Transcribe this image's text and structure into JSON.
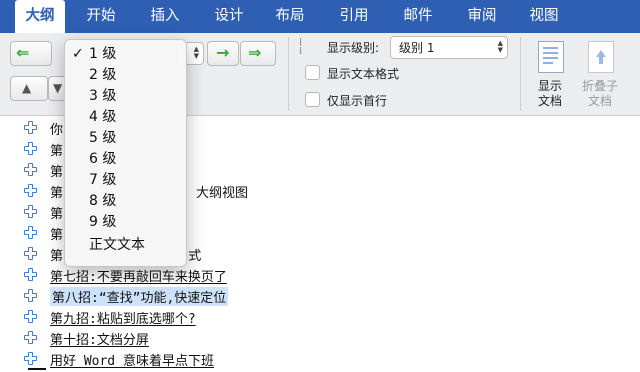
{
  "tabs": [
    "大纲",
    "开始",
    "插入",
    "设计",
    "布局",
    "引用",
    "邮件",
    "审阅",
    "视图"
  ],
  "toolbar": {
    "show_level_label": "显示级别:",
    "show_level_value": "级别 1",
    "show_text_format": "显示文本格式",
    "show_first_line": "仅显示首行",
    "show_doc_label": "显示\n文档",
    "collapse_subdoc_label": "折叠子\n文档"
  },
  "menu": {
    "items": [
      {
        "label": "1 级",
        "checked": true
      },
      {
        "label": "2 级",
        "checked": false
      },
      {
        "label": "3 级",
        "checked": false
      },
      {
        "label": "4 级",
        "checked": false
      },
      {
        "label": "5 级",
        "checked": false
      },
      {
        "label": "6 级",
        "checked": false
      },
      {
        "label": "7 级",
        "checked": false
      },
      {
        "label": "8 级",
        "checked": false
      },
      {
        "label": "9 级",
        "checked": false
      },
      {
        "label": "正文文本",
        "checked": false
      }
    ],
    "check_mark": "✓"
  },
  "outline": [
    "你",
    "第",
    "第",
    "第                 大纲视图",
    "第",
    "第",
    "第                式",
    "第七招:不要再敲回车来换页了",
    "第八招:“查找”功能,快速定位",
    "第九招:粘贴到底选哪个?",
    "第十招:文档分屏",
    "用好 Word 意味着早点下班"
  ],
  "highlighted_row": 8,
  "colors": {
    "ribbon": "#2f5fb3",
    "accent_green": "#3aa33a",
    "plus_blue": "#3d7fd6",
    "highlight": "#cfe2fb"
  }
}
